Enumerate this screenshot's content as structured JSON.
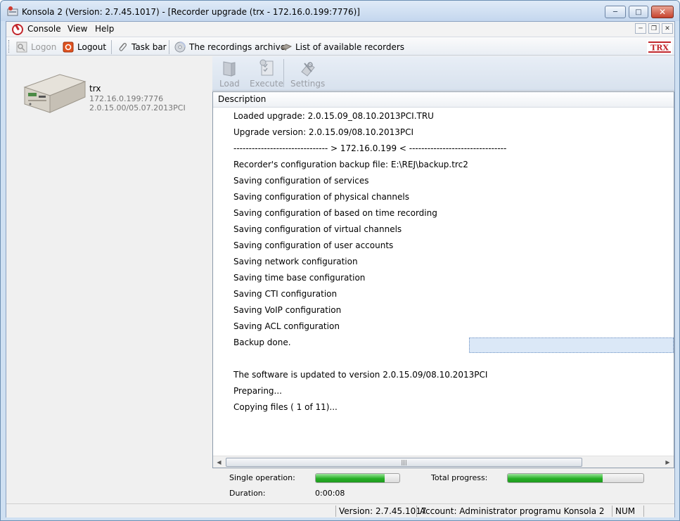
{
  "window": {
    "title": "Konsola 2 (Version:  2.7.45.1017) - [Recorder upgrade (trx - 172.16.0.199:7776)]"
  },
  "menu": {
    "items": [
      "Console",
      "View",
      "Help"
    ]
  },
  "toolbar": {
    "logon_label": "Logon",
    "logout_label": "Logout",
    "taskbar_label": "Task bar",
    "archive_label": "The recordings archive",
    "recorders_label": "List of available recorders",
    "brand": "TRX"
  },
  "device": {
    "name": "trx",
    "address": "172.16.0.199:7776",
    "version": "2.0.15.00/05.07.2013PCI"
  },
  "upgrade_toolbar": {
    "load_label": "Load",
    "execute_label": "Execute",
    "settings_label": "Settings"
  },
  "log": {
    "column_header": "Description",
    "rows": [
      "Loaded upgrade: 2.0.15.09_08.10.2013PCI.TRU",
      "Upgrade version: 2.0.15.09/08.10.2013PCI",
      "------------------------------- > 172.16.0.199 < --------------------------------",
      "Recorder's configuration backup file: E:\\REJ\\backup.trc2",
      "Saving configuration of services",
      "Saving configuration of physical channels",
      "Saving configuration of based on time recording",
      "Saving configuration of virtual channels",
      "Saving configuration of user accounts",
      "Saving network configuration",
      "Saving time base configuration",
      "Saving CTI configuration",
      "Saving VoIP configuration",
      "Saving ACL configuration",
      "Backup done.",
      "",
      "The software is updated to version 2.0.15.09/08.10.2013PCI",
      "Preparing...",
      "Copying files ( 1 of 11)..."
    ]
  },
  "progress": {
    "single_label": "Single operation:",
    "single_value": 0.82,
    "total_label": "Total progress:",
    "total_value": 0.7,
    "duration_label": "Duration:",
    "duration_value": "0:00:08"
  },
  "statusbar": {
    "version": "Version: 2.7.45.1017",
    "account": "Account: Administrator programu Konsola 2",
    "num": "NUM"
  },
  "colors": {
    "progress_green": "#27b027",
    "brand_red": "#c2262b"
  }
}
